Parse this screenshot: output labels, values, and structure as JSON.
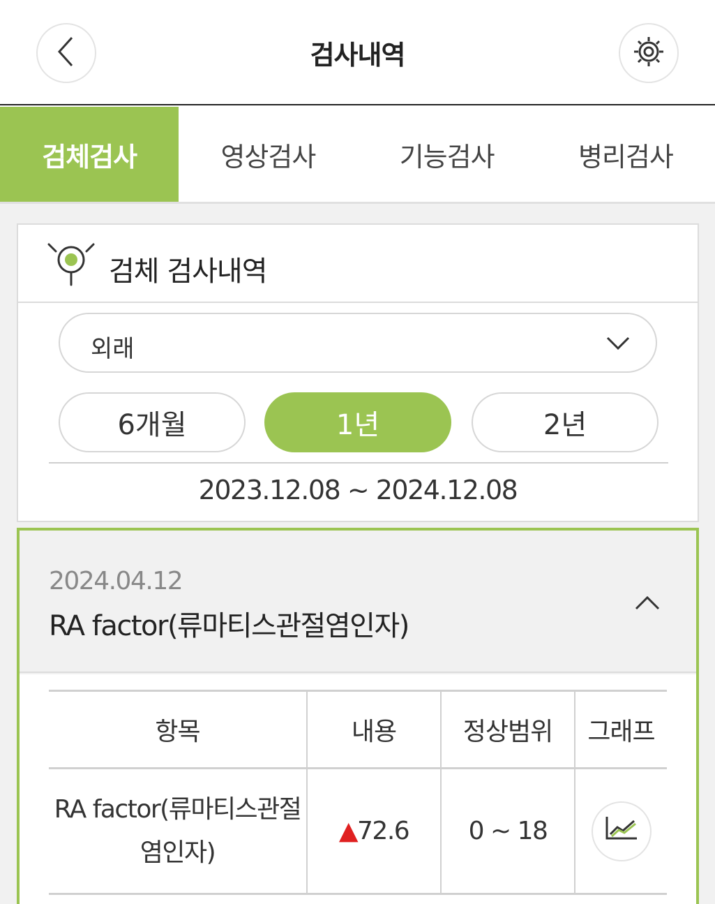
{
  "header": {
    "title": "검사내역",
    "back_icon": "chevron-left-icon",
    "settings_icon": "gear-icon"
  },
  "tabs": [
    {
      "label": "검체검사",
      "active": true
    },
    {
      "label": "영상검사",
      "active": false
    },
    {
      "label": "기능검사",
      "active": false
    },
    {
      "label": "병리검사",
      "active": false
    }
  ],
  "filter": {
    "title": "검체 검사내역",
    "icon": "specimen-icon",
    "dropdown_value": "외래",
    "periods": [
      {
        "label": "6개월",
        "active": false
      },
      {
        "label": "1년",
        "active": true
      },
      {
        "label": "2년",
        "active": false
      }
    ],
    "date_range": "2023.12.08 ~ 2024.12.08"
  },
  "result": {
    "date": "2024.04.12",
    "name": "RA factor(류마티스관절염인자)",
    "columns": [
      "항목",
      "내용",
      "정상범위",
      "그래프"
    ],
    "rows": [
      {
        "item": "RA factor(류마티스관절염인자)",
        "flag": "▲",
        "value": "72.6",
        "range": "0 ~ 18",
        "graph_icon": "line-chart-icon"
      }
    ]
  },
  "colors": {
    "accent": "#9bc452",
    "alert": "#e02020",
    "background": "#f1f1f1"
  }
}
